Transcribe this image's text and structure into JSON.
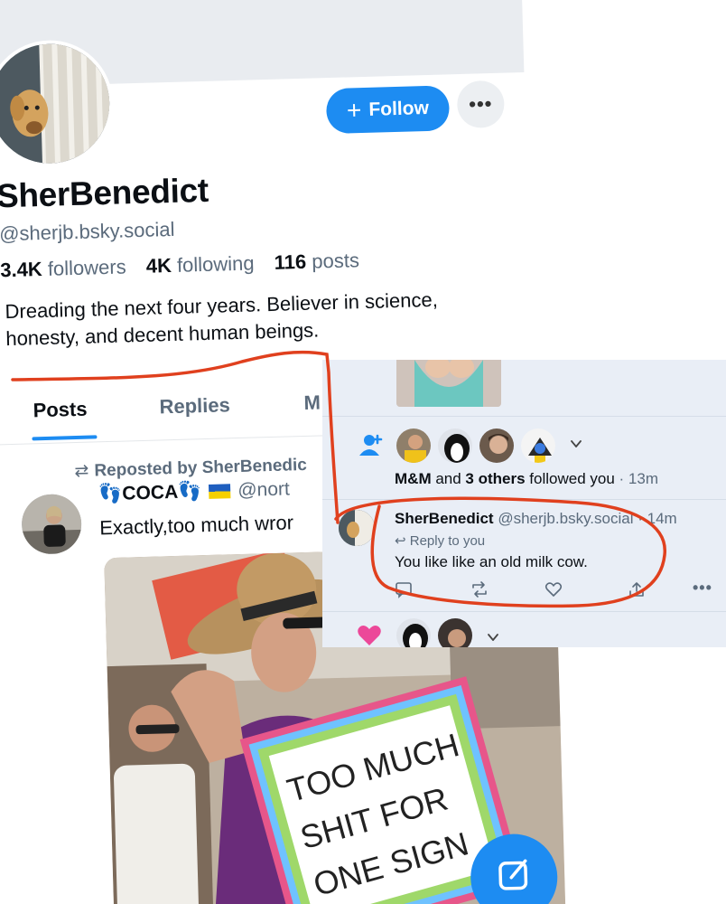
{
  "profile": {
    "display_name": "SherBenedict",
    "handle": "@sherjb.bsky.social",
    "follow_label": "Follow",
    "more_label": "•••",
    "followers_count": "3.4K",
    "followers_label": "followers",
    "following_count": "4K",
    "following_label": "following",
    "posts_count": "116",
    "posts_label": "posts",
    "bio": "Dreading the next four years. Believer in science, honesty, and decent human beings."
  },
  "tabs": [
    {
      "label": "Posts",
      "active": true
    },
    {
      "label": "Replies",
      "active": false
    },
    {
      "label": "M",
      "active": false
    }
  ],
  "post": {
    "repost_label": "Reposted by SherBenedic",
    "author_name": "👣COCA👣",
    "author_handle": "@nort",
    "text": "Exactly,too much wror",
    "image_sign_lines": [
      "TOO MUCH",
      "SHIT FOR",
      "ONE SIGN"
    ]
  },
  "notifications": {
    "follow_notice": {
      "lead": "M&M",
      "middle": " and ",
      "others": "3 others",
      "action": " followed you",
      "time": " · 13m"
    },
    "reply": {
      "author_name": "SherBenedict",
      "author_handle": "@sherjb.bsky.social",
      "time": "· 14m",
      "reply_to_label": "Reply to you",
      "text": "You like like an old milk cow.",
      "more_label": "•••"
    }
  },
  "colors": {
    "accent": "#1d8cf2",
    "annotation": "#e0401e",
    "like_pink": "#ec4899"
  }
}
